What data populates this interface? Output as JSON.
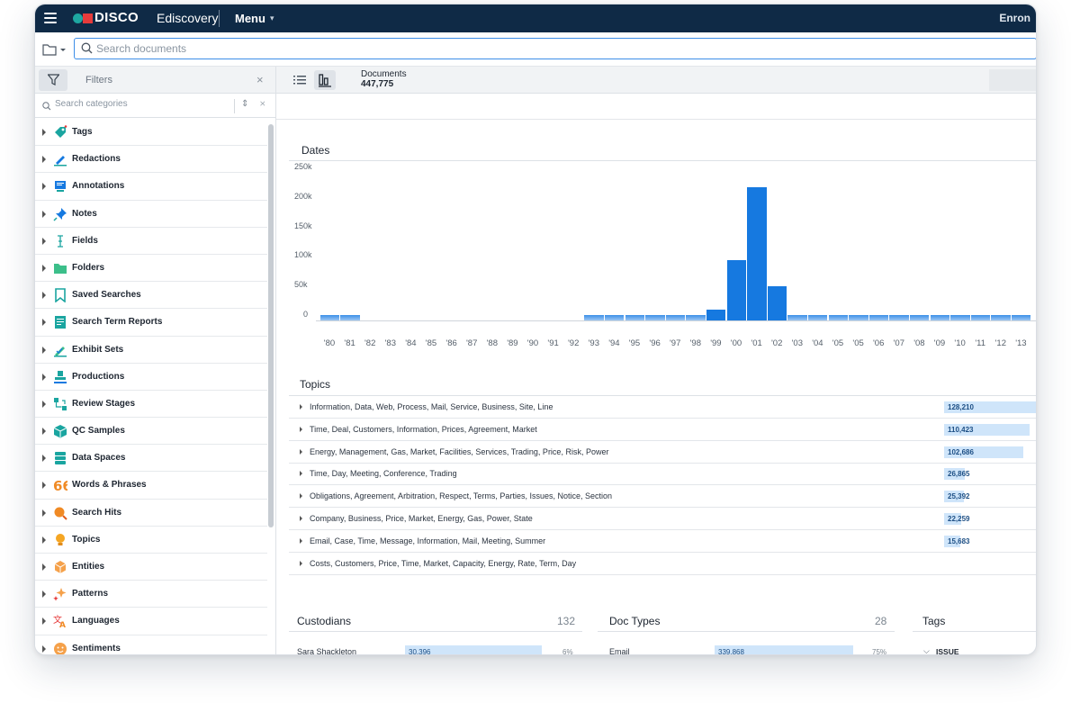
{
  "header": {
    "brand": "DISCO",
    "product": "Ediscovery",
    "menu_label": "Menu",
    "matter": "Enron",
    "colors": {
      "bar": "#0f2a46",
      "logo_dot": "#1ea7a1",
      "logo_square": "#e63b3b"
    }
  },
  "search": {
    "placeholder": "Search documents"
  },
  "filters": {
    "title": "Filters",
    "category_search_placeholder": "Search categories",
    "categories": [
      {
        "label": "Tags",
        "icon": "tag-icon"
      },
      {
        "label": "Redactions",
        "icon": "marker-icon"
      },
      {
        "label": "Annotations",
        "icon": "monitor-icon"
      },
      {
        "label": "Notes",
        "icon": "pushpin-icon"
      },
      {
        "label": "Fields",
        "icon": "text-cursor-icon"
      },
      {
        "label": "Folders",
        "icon": "folder-icon"
      },
      {
        "label": "Saved Searches",
        "icon": "bookmark-icon"
      },
      {
        "label": "Search Term Reports",
        "icon": "report-icon"
      },
      {
        "label": "Exhibit Sets",
        "icon": "pen-check-icon"
      },
      {
        "label": "Productions",
        "icon": "stamp-icon"
      },
      {
        "label": "Review Stages",
        "icon": "workflow-icon"
      },
      {
        "label": "QC Samples",
        "icon": "cube-icon"
      },
      {
        "label": "Data Spaces",
        "icon": "database-icon"
      },
      {
        "label": "Words & Phrases",
        "icon": "quote-icon"
      },
      {
        "label": "Search Hits",
        "icon": "magnifier-hit-icon"
      },
      {
        "label": "Topics",
        "icon": "lightbulb-icon"
      },
      {
        "label": "Entities",
        "icon": "hexagon-icon"
      },
      {
        "label": "Patterns",
        "icon": "sparkle-icon"
      },
      {
        "label": "Languages",
        "icon": "translate-icon"
      },
      {
        "label": "Sentiments",
        "icon": "smiley-icon"
      }
    ]
  },
  "toolbar": {
    "documents_label": "Documents",
    "documents_count": "447,775"
  },
  "dates": {
    "title": "Dates",
    "y_ticks": [
      "250k",
      "200k",
      "150k",
      "100k",
      "50k",
      "0"
    ]
  },
  "chart_data": {
    "type": "bar",
    "title": "Dates",
    "ylim": [
      0,
      250000
    ],
    "categories": [
      "'80",
      "'81",
      "'82",
      "'83",
      "'84",
      "'85",
      "'86",
      "'87",
      "'88",
      "'89",
      "'90",
      "'91",
      "'92",
      "'93",
      "'94",
      "'95",
      "'96",
      "'97",
      "'98",
      "'99",
      "'00",
      "'01",
      "'02",
      "'03",
      "'04",
      "'05",
      "'05",
      "'06",
      "'07",
      "'08",
      "'09",
      "'10",
      "'11",
      "'12",
      "'13"
    ],
    "values": [
      1200,
      1200,
      0,
      0,
      0,
      0,
      0,
      0,
      0,
      0,
      0,
      0,
      0,
      1200,
      1200,
      1200,
      1200,
      1200,
      2500,
      18000,
      102000,
      226000,
      58000,
      1200,
      1200,
      1200,
      1200,
      1200,
      1200,
      1200,
      5000,
      1200,
      1200,
      1200,
      1200
    ]
  },
  "topics": {
    "title": "Topics",
    "rows": [
      {
        "label": "Information, Data, Web, Process, Mail, Service, Business, Site, Line",
        "count": "128,210",
        "value": 128210
      },
      {
        "label": "Time, Deal, Customers, Information, Prices, Agreement, Market",
        "count": "110,423",
        "value": 110423
      },
      {
        "label": "Energy, Management, Gas, Market, Facilities, Services, Trading, Price, Risk, Power",
        "count": "102,686",
        "value": 102686
      },
      {
        "label": "Time, Day, Meeting, Conference, Trading",
        "count": "26,865",
        "value": 26865
      },
      {
        "label": "Obligations, Agreement, Arbitration, Respect, Terms, Parties, Issues, Notice, Section",
        "count": "25,392",
        "value": 25392
      },
      {
        "label": "Company, Business, Price, Market, Energy, Gas, Power, State",
        "count": "22,259",
        "value": 22259
      },
      {
        "label": "Email, Case, Time, Message, Information, Mail, Meeting, Summer",
        "count": "15,683",
        "value": 15683
      },
      {
        "label": "Costs, Customers, Price, Time, Market, Capacity, Energy, Rate, Term, Day",
        "count": "",
        "value": 0
      }
    ]
  },
  "custodians": {
    "title": "Custodians",
    "count": "132",
    "first": {
      "name": "Sara Shackleton",
      "value": "30,396",
      "pct": "6%"
    }
  },
  "doctypes": {
    "title": "Doc Types",
    "count": "28",
    "first": {
      "name": "Email",
      "value": "339,868",
      "pct": "75%"
    }
  },
  "tags_panel": {
    "title": "Tags",
    "first": "ISSUE"
  }
}
